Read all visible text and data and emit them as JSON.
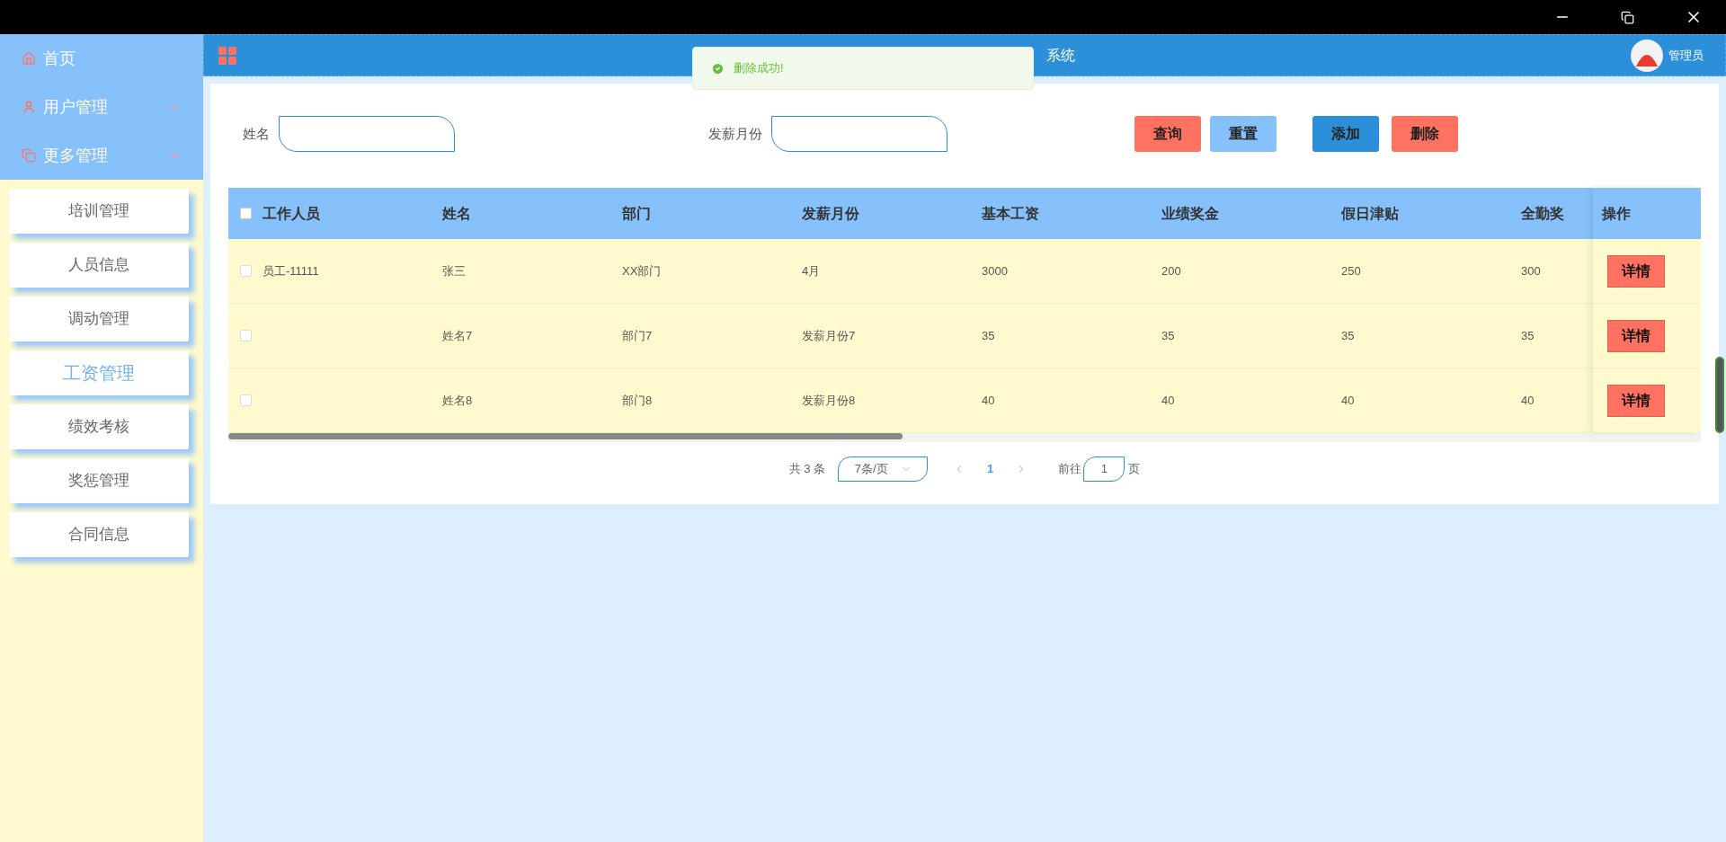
{
  "header": {
    "title": "系统",
    "user": "管理员"
  },
  "toast": {
    "message": "删除成功!"
  },
  "sidebar": {
    "items": [
      {
        "label": "首页",
        "kind": "plain"
      },
      {
        "label": "用户管理",
        "expanded": false,
        "kind": "group"
      },
      {
        "label": "更多管理",
        "expanded": true,
        "kind": "group",
        "children": [
          {
            "label": "培训管理",
            "selected": false
          },
          {
            "label": "人员信息",
            "selected": false
          },
          {
            "label": "调动管理",
            "selected": false
          },
          {
            "label": "工资管理",
            "selected": true
          },
          {
            "label": "绩效考核",
            "selected": false
          },
          {
            "label": "奖惩管理",
            "selected": false
          },
          {
            "label": "合同信息",
            "selected": false
          }
        ]
      }
    ]
  },
  "search": {
    "fields": [
      {
        "label": "姓名"
      },
      {
        "label": "发薪月份"
      }
    ],
    "buttons": [
      {
        "label": "查询",
        "kind": "danger"
      },
      {
        "label": "重置",
        "kind": "light"
      },
      {
        "label": "添加",
        "kind": "primary"
      },
      {
        "label": "删除",
        "kind": "danger"
      }
    ]
  },
  "table": {
    "all_checked": false,
    "columns": [
      "工作人员",
      "姓名",
      "部门",
      "发薪月份",
      "基本工资",
      "业绩奖金",
      "假日津贴",
      "全勤奖"
    ],
    "action_column": "操作",
    "rows": [
      {
        "checked": false,
        "cells": [
          "员工-11111",
          "张三",
          "XX部门",
          "4月",
          "3000",
          "200",
          "250",
          "300"
        ],
        "action": "详情"
      },
      {
        "checked": false,
        "cells": [
          "",
          "姓名7",
          "部门7",
          "发薪月份7",
          "35",
          "35",
          "35",
          "35"
        ],
        "action": "详情"
      },
      {
        "checked": false,
        "cells": [
          "",
          "姓名8",
          "部门8",
          "发薪月份8",
          "40",
          "40",
          "40",
          "40"
        ],
        "action": "详情"
      }
    ]
  },
  "pagination": {
    "total": "共 3 条",
    "page_size": "7条/页",
    "pages": [
      {
        "label": "1",
        "selected": true
      }
    ],
    "goto_label": "前往",
    "goto_value": "1",
    "goto_suffix": "页"
  }
}
